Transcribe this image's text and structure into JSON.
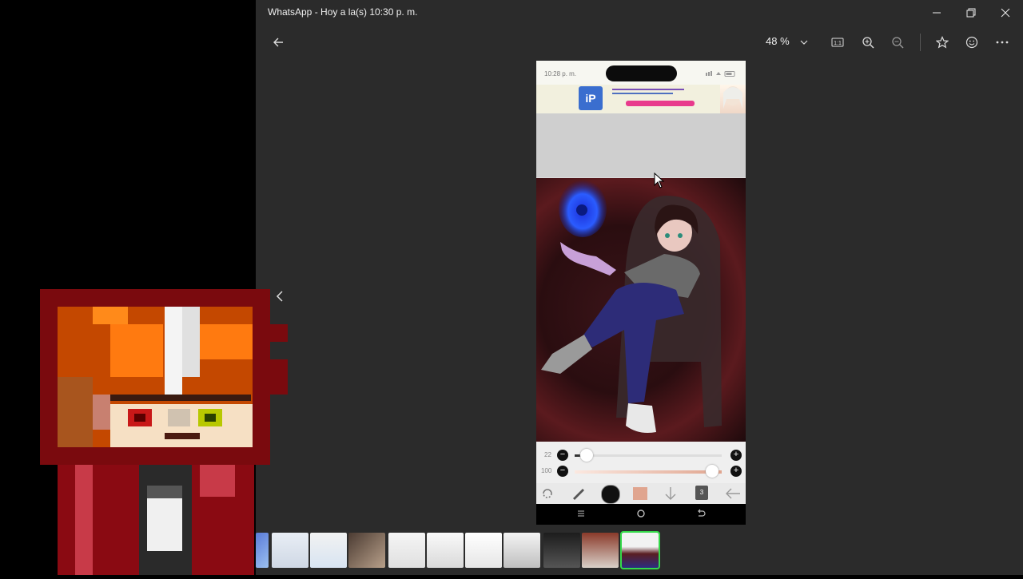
{
  "window": {
    "title": "WhatsApp - Hoy a la(s) 10:30 p. m.",
    "minimize_icon": "minimize-icon",
    "restore_icon": "restore-icon",
    "close_icon": "close-icon"
  },
  "toolbar": {
    "zoom_level": "48 %",
    "back_icon": "arrow-left-icon",
    "icons": [
      "chevron-down-icon",
      "actual-size-icon",
      "zoom-in-icon",
      "zoom-out-icon",
      "star-icon",
      "smiley-icon",
      "more-icon"
    ]
  },
  "phone": {
    "status_time": "10:28 p. m.",
    "slider_size_label": "22",
    "slider_opacity_label": "100",
    "size_level": 0.08,
    "opacity_level": 1.0,
    "layer_count": "3"
  },
  "thumbnails": {
    "count": 11,
    "selected_index": 10
  },
  "colors": {
    "viewer_bg": "#2b2b2b",
    "selected_outline": "#35d94a",
    "brush_color": "#e0a58f"
  }
}
